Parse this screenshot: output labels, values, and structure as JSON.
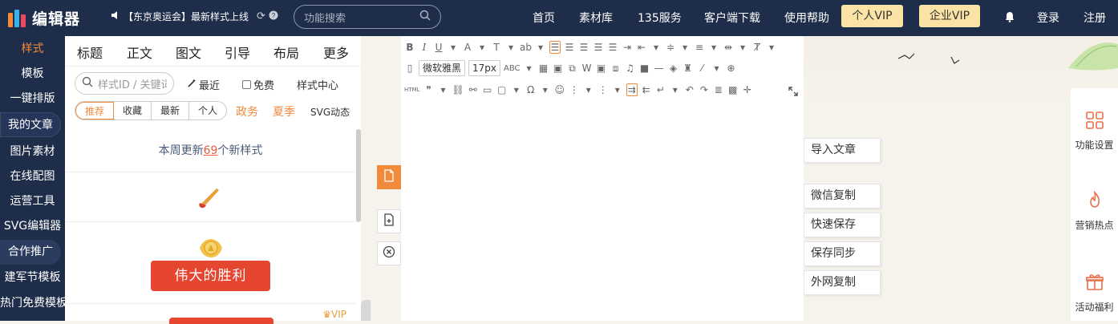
{
  "header": {
    "logo_text": "编辑器",
    "notice": "【东京奥运会】最新样式上线",
    "search_placeholder": "功能搜索",
    "nav": [
      "首页",
      "素材库",
      "135服务",
      "客户端下载",
      "使用帮助"
    ],
    "vip_personal": "个人VIP",
    "vip_enterprise": "企业VIP",
    "login": "登录",
    "register": "注册"
  },
  "leftnav": {
    "items": [
      "样式",
      "模板",
      "一键排版",
      "我的文章",
      "图片素材",
      "在线配图",
      "运营工具",
      "SVG编辑器",
      "合作推广",
      "建军节模板",
      "热门免费模板"
    ]
  },
  "panel": {
    "tabs": [
      "标题",
      "正文",
      "图文",
      "引导",
      "布局",
      "更多"
    ],
    "search_placeholder": "样式ID / 关键词",
    "recent": "最近",
    "free": "免费",
    "style_center": "样式中心",
    "segments": [
      "推荐",
      "收藏",
      "最新",
      "个人"
    ],
    "categories": [
      "政务",
      "夏季",
      "SVG动态"
    ],
    "feed_prefix": "本周更新",
    "feed_count": "69",
    "feed_suffix": "个新样式",
    "card_button": "伟大的胜利",
    "vip_tag": "VIP"
  },
  "editor": {
    "font_name": "微软雅黑",
    "font_size": "17px"
  },
  "actions": [
    "导入文章",
    "微信复制",
    "快速保存",
    "保存同步",
    "外网复制"
  ],
  "right_panel": [
    "功能设置",
    "营销热点",
    "活动福利"
  ],
  "colors": {
    "navy": "#1e2d4a",
    "orange": "#f28a3c",
    "vip_gold": "#fbe3a6",
    "red": "#e6452f"
  }
}
